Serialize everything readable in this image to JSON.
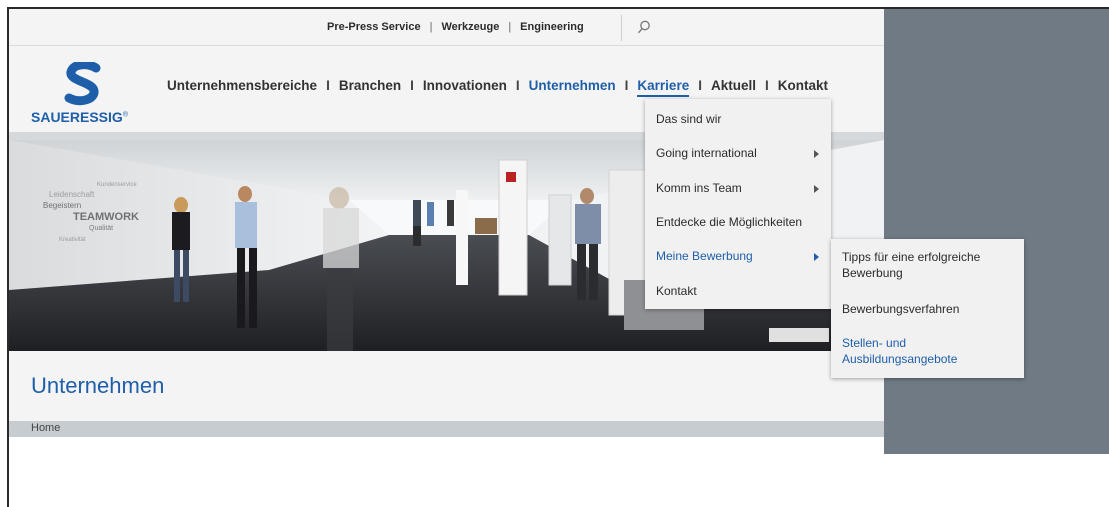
{
  "utility_nav": {
    "links": [
      "Pre-Press Service",
      "Werkzeuge",
      "Engineering"
    ],
    "separator": "|"
  },
  "logo": {
    "text": "SAUERESSIG",
    "mark": "®"
  },
  "main_nav": {
    "items": [
      "Unternehmensbereiche",
      "Branchen",
      "Innovationen",
      "Unternehmen",
      "Karriere",
      "Aktuell",
      "Kontakt"
    ],
    "separator": "I",
    "active_index": 3,
    "open_index": 4
  },
  "dropdown": {
    "items": [
      {
        "label": "Das sind wir",
        "has_submenu": false
      },
      {
        "label": "Going international",
        "has_submenu": true
      },
      {
        "label": "Komm ins Team",
        "has_submenu": true
      },
      {
        "label": "Entdecke die Möglichkeiten",
        "has_submenu": false
      },
      {
        "label": "Meine Bewerbung",
        "has_submenu": true,
        "active": true
      },
      {
        "label": "Kontakt",
        "has_submenu": false
      }
    ]
  },
  "submenu": {
    "items": [
      {
        "label": "Tipps für eine erfolgreiche Bewerbung"
      },
      {
        "label": "Bewerbungsverfahren"
      },
      {
        "label": "Stellen- und Ausbildungsangebote",
        "active": true
      }
    ]
  },
  "hero": {
    "wall_words": [
      "Kundenservice",
      "Leidenschaft",
      "Begeistern",
      "TEAMWORK",
      "Qualität",
      "Kreativität",
      "Verantwortung",
      "Innovativ"
    ]
  },
  "page": {
    "title": "Unternehmen",
    "breadcrumb": "Home"
  },
  "colors": {
    "brand_blue": "#1f5faa",
    "right_panel": "#6f7a84"
  },
  "icons": {
    "search": "search-icon"
  }
}
